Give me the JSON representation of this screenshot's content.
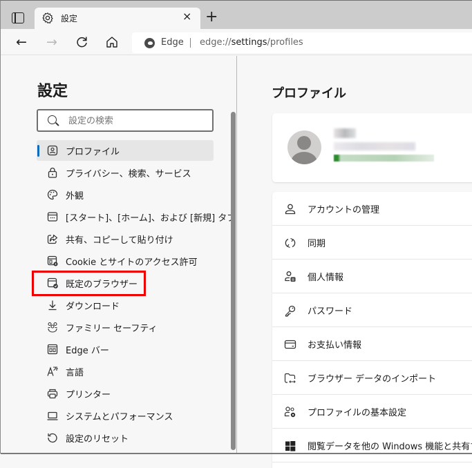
{
  "browser": {
    "tab": {
      "title": "設定",
      "icon": "gear-icon",
      "close_label": "×"
    },
    "new_tab_label": "+",
    "toolbar": {
      "back": "←",
      "forward": "→",
      "refresh": "↻",
      "home": "⌂"
    },
    "address": {
      "site_name": "Edge",
      "url_prefix": "edge://",
      "url_host": "settings",
      "url_path": "/profiles"
    }
  },
  "sidebar": {
    "title": "設定",
    "search_placeholder": "設定の検索",
    "items": [
      {
        "label": "プロファイル",
        "icon": "profile-icon",
        "active": true
      },
      {
        "label": "プライバシー、検索、サービス",
        "icon": "lock-icon"
      },
      {
        "label": "外観",
        "icon": "palette-icon"
      },
      {
        "label": "[スタート]、[ホーム]、および [新規] タブ",
        "icon": "start-page-icon"
      },
      {
        "label": "共有、コピーして貼り付け",
        "icon": "share-icon"
      },
      {
        "label": "Cookie とサイトのアクセス許可",
        "icon": "site-permissions-icon"
      },
      {
        "label": "既定のブラウザー",
        "icon": "default-browser-icon",
        "highlighted": true
      },
      {
        "label": "ダウンロード",
        "icon": "download-icon"
      },
      {
        "label": "ファミリー セーフティ",
        "icon": "family-icon"
      },
      {
        "label": "Edge バー",
        "icon": "edge-bar-icon"
      },
      {
        "label": "言語",
        "icon": "language-icon"
      },
      {
        "label": "プリンター",
        "icon": "printer-icon"
      },
      {
        "label": "システムとパフォーマンス",
        "icon": "laptop-icon"
      },
      {
        "label": "設定のリセット",
        "icon": "reset-icon"
      }
    ]
  },
  "main": {
    "page_title": "プロファイル",
    "profile_card": {
      "avatar": "default-avatar",
      "name": "(blurred)",
      "email": "(blurred)",
      "status_color": "#2e8b2e"
    },
    "list": [
      {
        "label": "アカウントの管理",
        "icon": "person-icon"
      },
      {
        "label": "同期",
        "icon": "sync-icon"
      },
      {
        "label": "個人情報",
        "icon": "personal-info-icon"
      },
      {
        "label": "パスワード",
        "icon": "key-icon"
      },
      {
        "label": "お支払い情報",
        "icon": "card-icon"
      },
      {
        "label": "ブラウザー データのインポート",
        "icon": "import-icon"
      },
      {
        "label": "プロファイルの基本設定",
        "icon": "profile-settings-icon"
      },
      {
        "label": "閲覧データを他の Windows 機能と共有す",
        "icon": "windows-icon"
      }
    ]
  },
  "colors": {
    "accent": "#0f6cbd",
    "highlight_box": "#ee0000"
  }
}
